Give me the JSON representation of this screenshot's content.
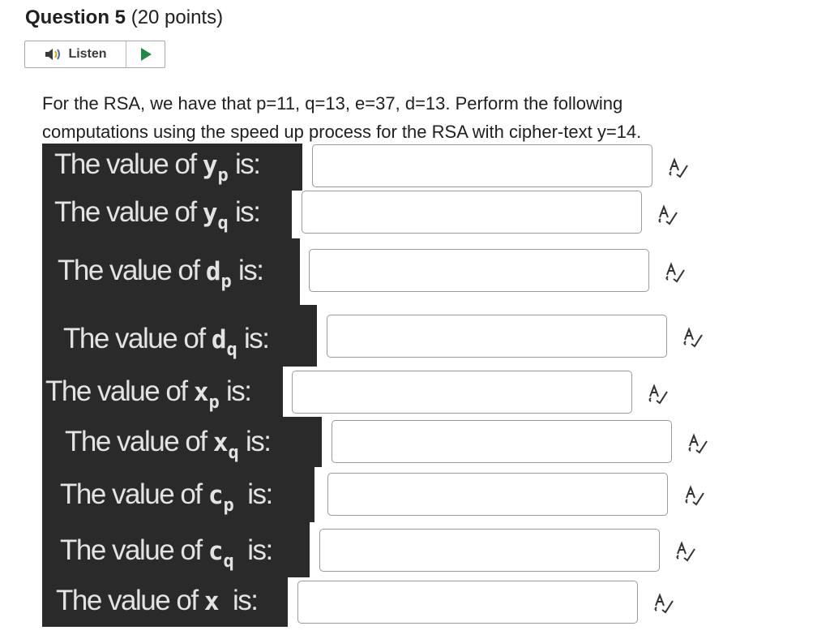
{
  "question": {
    "number_label": "Question 5",
    "points_label": "(20 points)"
  },
  "listen": {
    "label": "Listen"
  },
  "prompt": {
    "line1": "For the RSA, we have that p=11, q=13, e=37, d=13. Perform the following",
    "line2": "computations using the speed up process for the RSA with cipher-text y=14."
  },
  "fields": [
    {
      "prefix": "The value of ",
      "var": "y",
      "sub": "p",
      "suffix": " is:",
      "value": ""
    },
    {
      "prefix": "The value of ",
      "var": "y",
      "sub": "q",
      "suffix": " is:",
      "value": ""
    },
    {
      "prefix": "The value of ",
      "var": "d",
      "sub": "p",
      "suffix": " is:",
      "value": ""
    },
    {
      "prefix": "The value of ",
      "var": "d",
      "sub": "q",
      "suffix": " is:",
      "value": ""
    },
    {
      "prefix": "The value of ",
      "var": "x",
      "sub": "p",
      "suffix": " is:",
      "value": ""
    },
    {
      "prefix": "The value of ",
      "var": "x",
      "sub": "q",
      "suffix": " is:",
      "value": ""
    },
    {
      "prefix": "The value of ",
      "var": "c",
      "sub": "p",
      "suffix": "  is:",
      "value": ""
    },
    {
      "prefix": "The value of ",
      "var": "c",
      "sub": "q",
      "suffix": "  is:",
      "value": ""
    },
    {
      "prefix": "The value of ",
      "var": "x",
      "sub": "",
      "suffix": "  is:",
      "value": ""
    }
  ],
  "icons": {
    "listen": "speaker-icon",
    "play": "play-icon",
    "spellcheck": "spellcheck-icon"
  },
  "colors": {
    "label_bg": "#2a2a2a",
    "label_text": "#e3e3e3",
    "play": "#1f8a45",
    "speaker": "#4a6fa5"
  }
}
